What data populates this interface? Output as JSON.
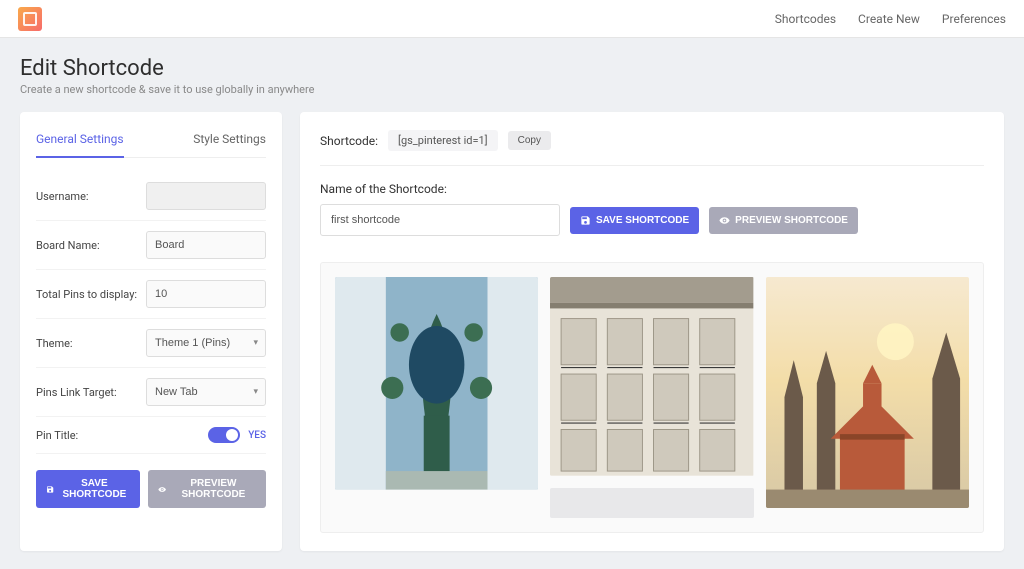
{
  "nav": {
    "shortcodes": "Shortcodes",
    "create_new": "Create New",
    "preferences": "Preferences"
  },
  "page": {
    "title": "Edit Shortcode",
    "subtitle": "Create a new shortcode & save it to use globally in anywhere"
  },
  "tabs": {
    "general": "General Settings",
    "style": "Style Settings"
  },
  "fields": {
    "username": {
      "label": "Username:",
      "value": ""
    },
    "board": {
      "label": "Board Name:",
      "value": "Board"
    },
    "total_pins": {
      "label": "Total Pins to display:",
      "value": "10"
    },
    "theme": {
      "label": "Theme:",
      "value": "Theme 1 (Pins)"
    },
    "link_target": {
      "label": "Pins Link Target:",
      "value": "New Tab"
    },
    "pin_title": {
      "label": "Pin Title:",
      "toggle_text": "YES"
    }
  },
  "buttons": {
    "save": "SAVE SHORTCODE",
    "preview": "PREVIEW SHORTCODE",
    "copy": "Copy"
  },
  "main": {
    "sc_label": "Shortcode:",
    "sc_code": "[gs_pinterest id=1]",
    "name_label": "Name of the Shortcode:",
    "name_value": "first shortcode"
  }
}
